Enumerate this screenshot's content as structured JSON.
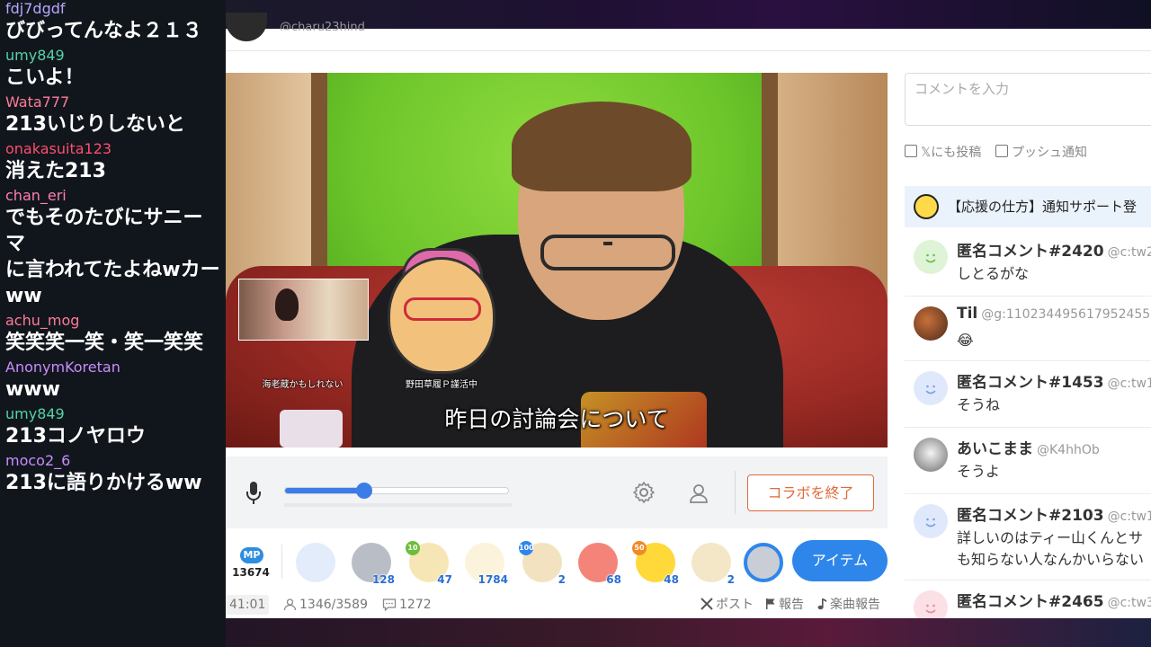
{
  "chat": {
    "messages": [
      {
        "user": "fdj7dgdf",
        "color": "#b9a6ff",
        "text": "びびってんなよ２１３"
      },
      {
        "user": "umy849",
        "color": "#56d1a8",
        "text": "こいよ！"
      },
      {
        "user": "Wata777",
        "color": "#ff7a9a",
        "text": "213いじりしないと"
      },
      {
        "user": "onakasuita123",
        "color": "#ff4d6d",
        "text": "消えた213"
      },
      {
        "user": "chan_eri",
        "color": "#ff7fb0",
        "text": "でもそのたびにサニーマ\nに言われてたよねwカー\nww"
      },
      {
        "user": "achu_mog",
        "color": "#ff7a9a",
        "text": "笑笑笑一笑・笑一笑笑"
      },
      {
        "user": "AnonymKoretan",
        "color": "#c88cff",
        "text": "www"
      },
      {
        "user": "umy849",
        "color": "#56d1a8",
        "text": "213コノヤロウ"
      },
      {
        "user": "moco2_6",
        "color": "#c88cff",
        "text": "213に語りかけるww"
      }
    ]
  },
  "header": {
    "host_handle": "@charu23hind"
  },
  "video": {
    "caption": "昨日の討論会について",
    "pip_label": "海老蔵かもしれない",
    "avatar_label": "野田草履Ｐ謹活中"
  },
  "controls": {
    "volume_level": 0.35,
    "end_collab_label": "コラボを終了"
  },
  "gifts": {
    "mp_label": "MP",
    "mp_count": "13674",
    "items": [
      {
        "name": "gift-smile",
        "color": "#e3ecfb",
        "count": "",
        "badge": ""
      },
      {
        "name": "gift-coin",
        "color": "#b9bec6",
        "count": "128",
        "badge": ""
      },
      {
        "name": "gift-drink",
        "color": "#f7e6b5",
        "count": "47",
        "badge": "10"
      },
      {
        "name": "gift-bun",
        "color": "#fbf3dc",
        "count": "1784",
        "badge": ""
      },
      {
        "name": "gift-ice",
        "color": "#f3e2c0",
        "count": "2",
        "badge": "100"
      },
      {
        "name": "gift-pink",
        "color": "#f4837a",
        "count": "68",
        "badge": ""
      },
      {
        "name": "gift-chick",
        "color": "#ffd93a",
        "count": "48",
        "badge": "50"
      },
      {
        "name": "gift-cup",
        "color": "#f3e7c8",
        "count": "2",
        "badge": ""
      },
      {
        "name": "gift-ring",
        "color": "#c9ced6",
        "count": "",
        "badge": ""
      }
    ],
    "item_button_label": "アイテム"
  },
  "footer": {
    "elapsed": "41:01",
    "viewers": "1346/3589",
    "comments": "1272",
    "post_label": "ポスト",
    "report_label": "報告",
    "music_report_label": "楽曲報告"
  },
  "right": {
    "comment_placeholder": "コメントを入力",
    "opt_x_label": "𝕏にも投稿",
    "opt_push_label": "プッシュ通知",
    "notice_text": "【応援の仕方】通知サポート登",
    "comments": [
      {
        "name": "匿名コメント#2420",
        "handle": "@c:tw2",
        "text": "しとるがな",
        "avatar": "green"
      },
      {
        "name": "Til",
        "handle": "@g:110234495617952455",
        "text": "😂",
        "avatar": "photo-til"
      },
      {
        "name": "匿名コメント#1453",
        "handle": "@c:tw1",
        "text": "そうね",
        "avatar": "blue"
      },
      {
        "name": "あいこまま",
        "handle": "@K4hhOb",
        "text": "そうよ",
        "avatar": "photo-aiko"
      },
      {
        "name": "匿名コメント#2103",
        "handle": "@c:tw1",
        "text": "詳しいのはティー山くんとサ\nも知らない人なんかいらない",
        "avatar": "blue"
      },
      {
        "name": "匿名コメント#2465",
        "handle": "@c:tw3",
        "text": "",
        "avatar": "pink"
      }
    ]
  }
}
